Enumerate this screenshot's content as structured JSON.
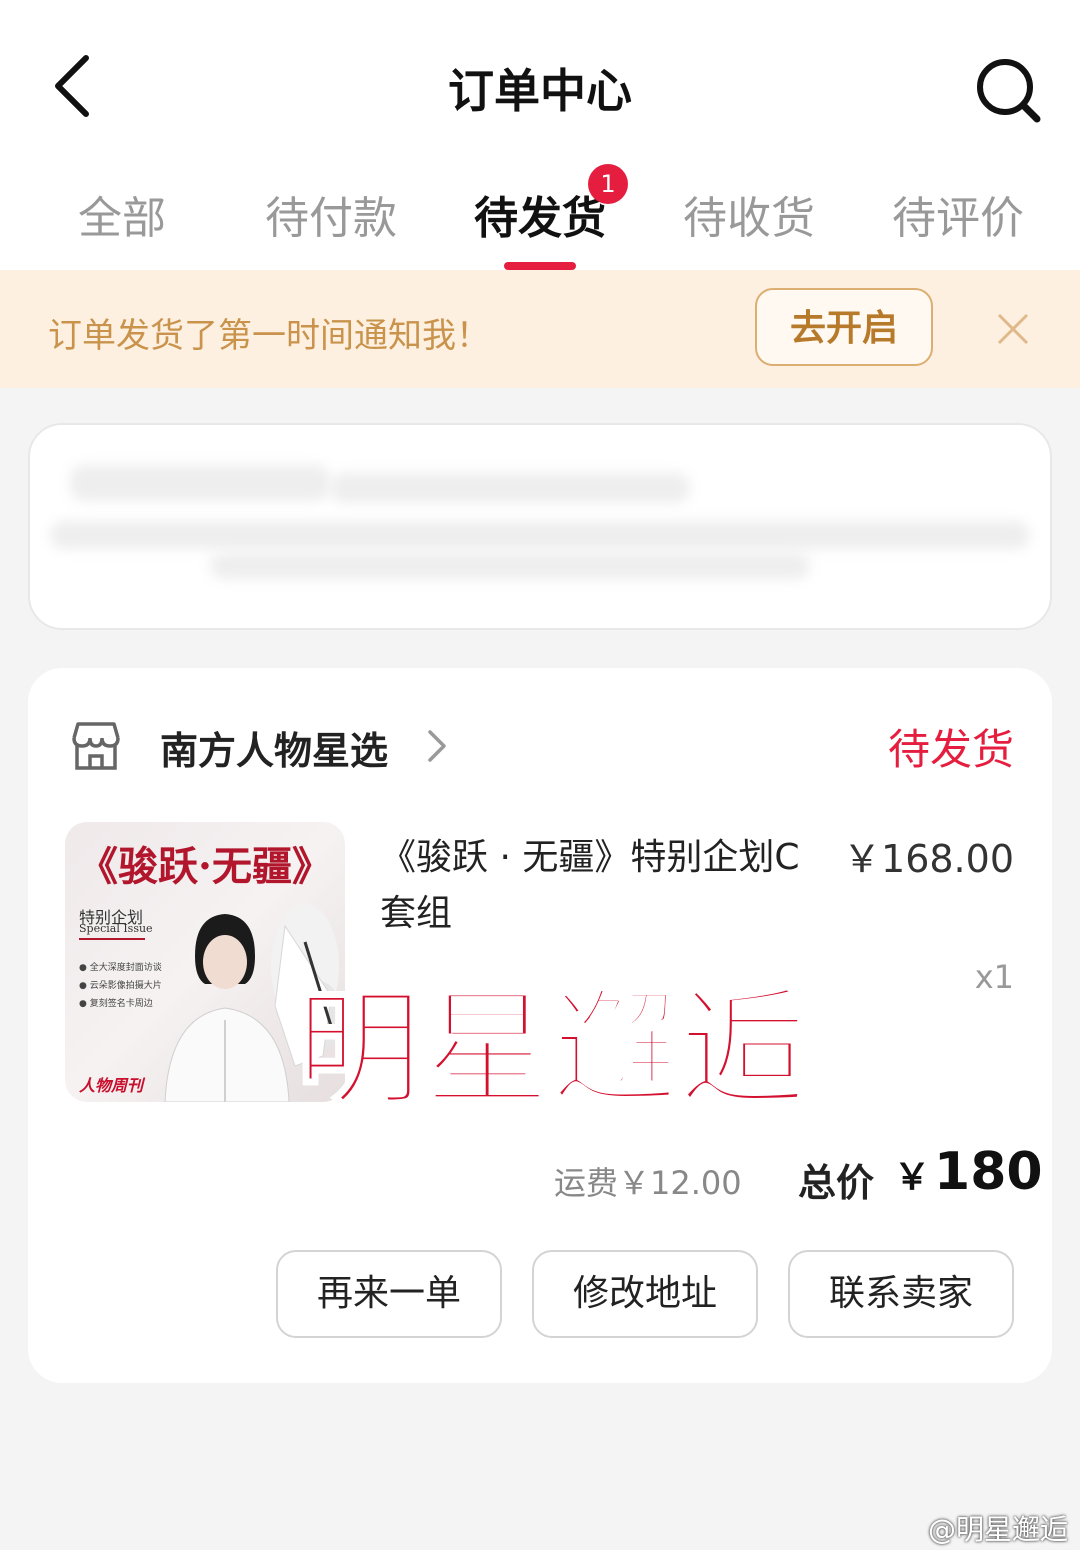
{
  "header": {
    "title": "订单中心",
    "back_icon": "chevron-left-icon",
    "search_icon": "search-icon"
  },
  "tabs": [
    {
      "label": "全部"
    },
    {
      "label": "待付款"
    },
    {
      "label": "待发货",
      "active": true,
      "badge": "1"
    },
    {
      "label": "待收货"
    },
    {
      "label": "待评价"
    }
  ],
  "notice": {
    "text": "订单发货了第一时间通知我！",
    "button": "去开启",
    "close_icon": "close-icon"
  },
  "order": {
    "shop_name": "南方人物星选",
    "status": "待发货",
    "product": {
      "title": "《骏跃 · 无疆》特别企划C套组",
      "price": "￥168.00",
      "quantity": "x1",
      "image": {
        "title": "《骏跃·无疆》",
        "subtitle": "特别企划",
        "subtitle_en": "Special Issue",
        "bullets": [
          "全大深度封面访谈",
          "云朵影像拍摄大片",
          "复刻签名卡周边"
        ],
        "logo": "人物周刊"
      }
    },
    "shipping": "运费￥12.00",
    "total_label": "总价",
    "total_symbol": "￥",
    "total_value": "180",
    "buttons": [
      "再来一单",
      "修改地址",
      "联系卖家"
    ]
  },
  "overlay_watermark": "明星邂逅",
  "footer_watermark": "@明星邂逅",
  "colors": {
    "accent": "#e51e3f",
    "notice_bg": "#fdf0e1",
    "notice_text": "#c9934c"
  }
}
